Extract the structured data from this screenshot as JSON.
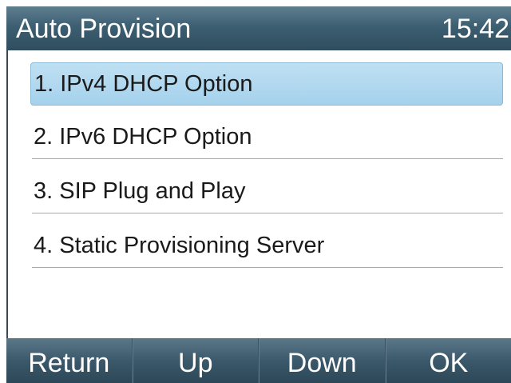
{
  "header": {
    "title": "Auto Provision",
    "time": "15:42"
  },
  "menu": {
    "items": [
      {
        "label": "1. IPv4 DHCP Option",
        "selected": true
      },
      {
        "label": "2. IPv6 DHCP Option",
        "selected": false
      },
      {
        "label": "3. SIP Plug and Play",
        "selected": false
      },
      {
        "label": "4. Static Provisioning Server",
        "selected": false
      }
    ]
  },
  "softkeys": {
    "return": "Return",
    "up": "Up",
    "down": "Down",
    "ok": "OK"
  },
  "colors": {
    "titlebar": "#3d5f72",
    "selection": "#a5d1ec"
  }
}
